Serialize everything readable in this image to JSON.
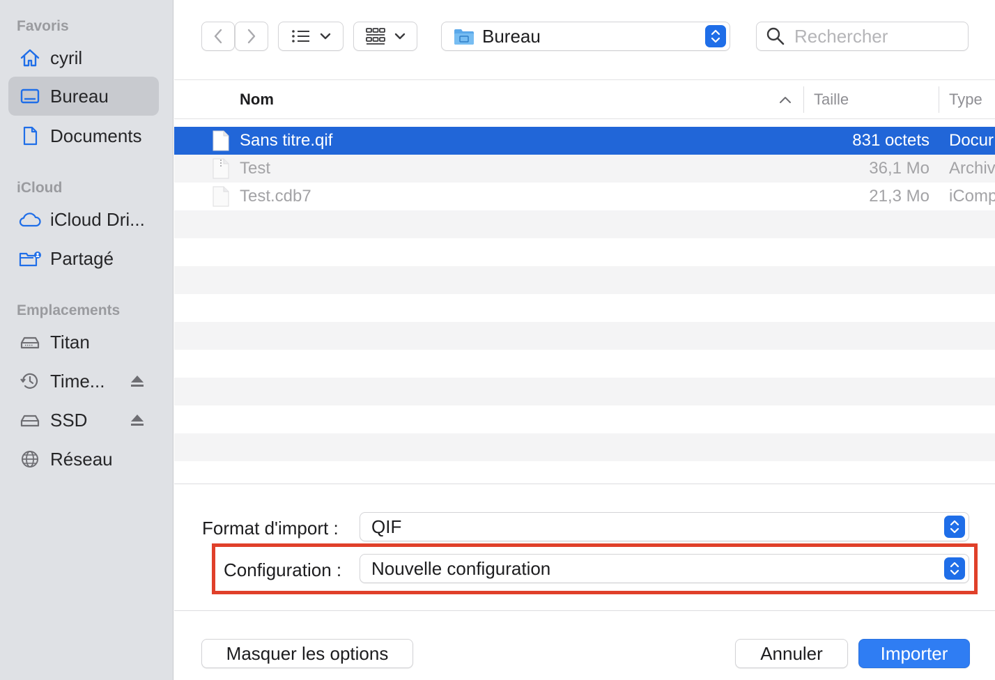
{
  "sidebar": {
    "sections": {
      "favorites": "Favoris",
      "icloud": "iCloud",
      "locations": "Emplacements"
    },
    "favorites": [
      {
        "label": "cyril",
        "icon": "home-icon"
      },
      {
        "label": "Bureau",
        "icon": "desktop-icon",
        "active": true
      },
      {
        "label": "Documents",
        "icon": "document-icon"
      }
    ],
    "icloud": [
      {
        "label": "iCloud Dri...",
        "icon": "cloud-icon"
      },
      {
        "label": "Partagé",
        "icon": "shared-folder-icon"
      }
    ],
    "locations": [
      {
        "label": "Titan",
        "icon": "drive-icon"
      },
      {
        "label": "Time...",
        "icon": "time-machine-icon",
        "eject": true
      },
      {
        "label": "SSD",
        "icon": "drive-icon",
        "eject": true
      },
      {
        "label": "Réseau",
        "icon": "network-icon"
      }
    ]
  },
  "toolbar": {
    "location": "Bureau",
    "search_placeholder": "Rechercher"
  },
  "columns": {
    "name": "Nom",
    "size": "Taille",
    "type": "Type"
  },
  "files": [
    {
      "name": "Sans titre.qif",
      "size": "831 octets",
      "type": "Docur",
      "state": "selected"
    },
    {
      "name": "Test",
      "size": "36,1 Mo",
      "type": "Archiv",
      "state": "disabled"
    },
    {
      "name": "Test.cdb7",
      "size": "21,3 Mo",
      "type": "iComp",
      "state": "disabled"
    }
  ],
  "options": {
    "format_label": "Format d'import :",
    "format_value": "QIF",
    "config_label": "Configuration :",
    "config_value": "Nouvelle configuration"
  },
  "buttons": {
    "hide_options": "Masquer les options",
    "cancel": "Annuler",
    "import": "Importer"
  },
  "colors": {
    "accent": "#2f7df3",
    "selection": "#2166d8",
    "highlight_border": "#e0402a",
    "sidebar_bg": "#dfe1e5"
  }
}
